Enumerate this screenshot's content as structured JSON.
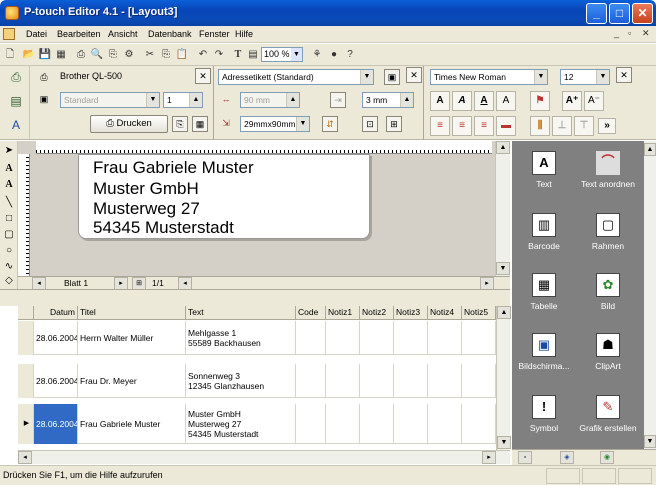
{
  "window": {
    "title": "P-touch Editor 4.1 - [Layout3]"
  },
  "menu": [
    "Datei",
    "Bearbeiten",
    "Ansicht",
    "Datenbank",
    "Fenster",
    "Hilfe"
  ],
  "toolbar": {
    "zoom": "100 %"
  },
  "printer": {
    "name": "Brother QL-500",
    "mode": "Standard",
    "copies": "1",
    "print_label": "Drucken",
    "label_type": "Adressetikett (Standard)",
    "width": "90 mm",
    "margin": "3 mm",
    "size": "29mmx90mm"
  },
  "font": {
    "family": "Times New Roman",
    "size": "12"
  },
  "label_text": {
    "line1": "Frau Gabriele Muster",
    "line2": "Muster GmbH",
    "line3": "Musterweg 27",
    "line4": "54345 Musterstadt"
  },
  "sheet": {
    "name": "Blatt 1",
    "pages": "1/1"
  },
  "table": {
    "headers": [
      "Datum",
      "Titel",
      "Text",
      "Code",
      "Notiz1",
      "Notiz2",
      "Notiz3",
      "Notiz4",
      "Notiz5"
    ],
    "rows": [
      {
        "datum": "28.06.2004",
        "titel": "Herrn Walter Müller",
        "text1": "Mehlgasse 1",
        "text2": "55589 Backhausen",
        "text3": ""
      },
      {
        "datum": "28.06.2004",
        "titel": "Frau Dr. Meyer",
        "text1": "Sonnenweg 3",
        "text2": "12345 Glanzhausen",
        "text3": ""
      },
      {
        "datum": "28.06.2004",
        "titel": "Frau Gabriele Muster",
        "text1": "Muster GmbH",
        "text2": "Musterweg 27",
        "text3": "54345 Musterstadt"
      }
    ]
  },
  "objects": [
    {
      "label": "Text",
      "icon": "text-icon"
    },
    {
      "label": "Text anordnen",
      "icon": "arrange-text-icon"
    },
    {
      "label": "Barcode",
      "icon": "barcode-icon"
    },
    {
      "label": "Rahmen",
      "icon": "frame-icon"
    },
    {
      "label": "Tabelle",
      "icon": "table-icon"
    },
    {
      "label": "Bild",
      "icon": "image-icon"
    },
    {
      "label": "Bildschirma...",
      "icon": "screenshot-icon"
    },
    {
      "label": "ClipArt",
      "icon": "clipart-icon"
    },
    {
      "label": "Symbol",
      "icon": "symbol-icon"
    },
    {
      "label": "Grafik erstellen",
      "icon": "create-graphic-icon"
    }
  ],
  "status": {
    "text": "Drücken Sie F1, um die Hilfe aufzurufen"
  }
}
